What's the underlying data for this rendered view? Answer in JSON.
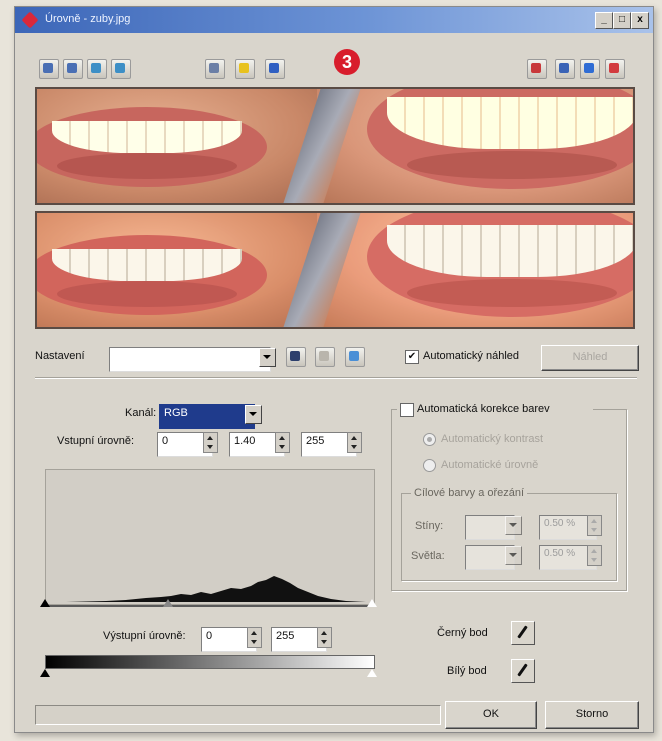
{
  "window": {
    "title": "Úrovně - zuby.jpg",
    "controls": {
      "minimize": "_",
      "maximize": "□",
      "close": "x"
    }
  },
  "toolbar": {
    "left_icons": [
      "zoom-in-icon",
      "zoom-out-icon",
      "fit-window-icon",
      "actual-size-icon",
      "split-compare-icon",
      "highlight-icon",
      "info-icon"
    ],
    "right_icons": [
      "view-side-by-side-icon",
      "view-top-bottom-icon",
      "view-single-blue-icon",
      "view-single-red-icon"
    ],
    "step_badge": "3"
  },
  "settings": {
    "label": "Nastavení",
    "value": "",
    "auto_preview_label": "Automatický náhled",
    "auto_preview_checked": true,
    "preview_button": "Náhled"
  },
  "levels": {
    "channel_label": "Kanál:",
    "channel_value": "RGB",
    "input_label": "Vstupní úrovně:",
    "input_black": "0",
    "input_gamma": "1.40",
    "input_white": "255",
    "output_label": "Výstupní úrovně:",
    "output_black": "0",
    "output_white": "255"
  },
  "auto_correction": {
    "checkbox_label": "Automatická korekce barev",
    "checked": false,
    "option_contrast": "Automatický kontrast",
    "option_levels": "Automatické úrovně",
    "target_group_label": "Cílové barvy a ořezání",
    "shadows_label": "Stíny:",
    "shadows_value": "0.50 %",
    "highlights_label": "Světla:",
    "highlights_value": "0.50 %"
  },
  "eyedroppers": {
    "black_point_label": "Černý bod",
    "white_point_label": "Bílý bod"
  },
  "buttons": {
    "ok": "OK",
    "cancel": "Storno"
  },
  "colors": {
    "titlebar": "#3c66b8",
    "channel_select": "#1f3b8c",
    "badge": "#d81d2c"
  }
}
